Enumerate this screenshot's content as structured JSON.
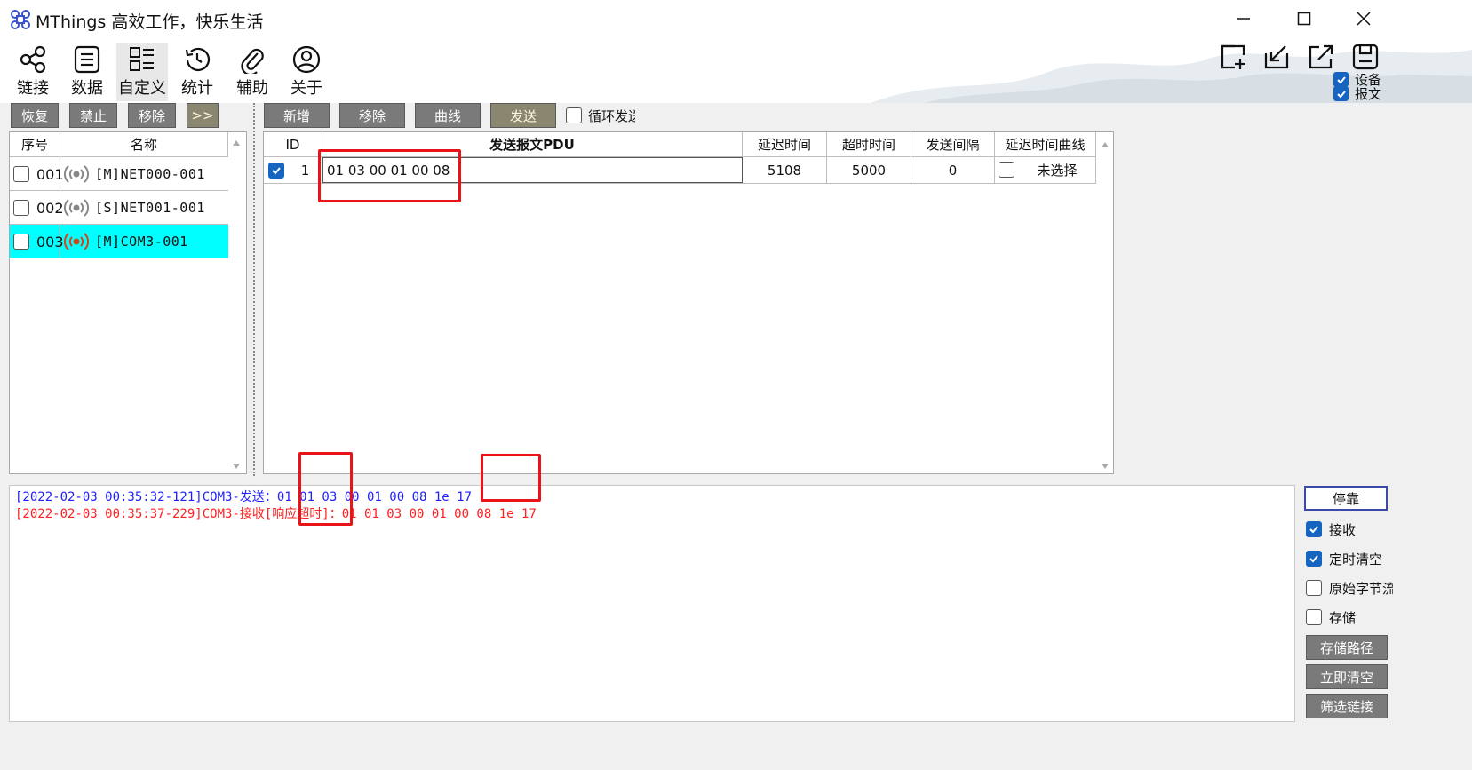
{
  "window": {
    "title": "MThings  高效工作，快乐生活",
    "controls": [
      "minimize-icon",
      "maximize-icon",
      "close-icon"
    ]
  },
  "toolbar": {
    "items": [
      {
        "label": "链接",
        "icon": "share-icon"
      },
      {
        "label": "数据",
        "icon": "list-icon"
      },
      {
        "label": "自定义",
        "icon": "grid-list-icon",
        "active": true
      },
      {
        "label": "统计",
        "icon": "history-icon"
      },
      {
        "label": "辅助",
        "icon": "paperclip-icon"
      },
      {
        "label": "关于",
        "icon": "user-icon"
      }
    ],
    "right_icons": [
      "add-window-icon",
      "import-icon",
      "export-icon",
      "save-icon"
    ],
    "right_checks": [
      {
        "label": "设备",
        "checked": true
      },
      {
        "label": "报文",
        "checked": true
      }
    ]
  },
  "device_panel": {
    "buttons": [
      "恢复",
      "禁止",
      "移除",
      ">>"
    ],
    "columns": [
      "序号",
      "名称"
    ],
    "rows": [
      {
        "num": "001",
        "name": "[M]NET000-001",
        "checked": false,
        "selected": false
      },
      {
        "num": "002",
        "name": "[S]NET001-001",
        "checked": false,
        "selected": false
      },
      {
        "num": "003",
        "name": "[M]COM3-001",
        "checked": false,
        "selected": true
      }
    ]
  },
  "send_panel": {
    "buttons": [
      "新增",
      "移除",
      "曲线",
      "发送"
    ],
    "loop_label": "循环发送",
    "loop_checked": false,
    "columns": [
      "ID",
      "发送报文PDU",
      "延迟时间",
      "超时时间",
      "发送间隔",
      "延迟时间曲线"
    ],
    "rows": [
      {
        "checked": true,
        "id": "1",
        "pdu": "01 03 00 01 00 08",
        "delay": "5108",
        "timeout": "5000",
        "interval": "0",
        "curve_checked": false,
        "curve": "未选择"
      }
    ]
  },
  "log": {
    "lines": [
      {
        "text": "[2022-02-03 00:35:32-121]COM3-发送：01 01 03 00 01 00 08 1e 17",
        "color": "#2020ff"
      },
      {
        "text": "[2022-02-03 00:35:37-229]COM3-接收[响应超时]：01 01 03 00 01 00 08 1e 17",
        "color": "#ff2020"
      }
    ]
  },
  "side_panel": {
    "dock_button": "停靠",
    "checks": [
      {
        "label": "接收",
        "checked": true
      },
      {
        "label": "定时清空",
        "checked": true
      },
      {
        "label": "原始字节流",
        "checked": false
      },
      {
        "label": "存储",
        "checked": false
      }
    ],
    "buttons": [
      "存储路径",
      "立即清空",
      "筛选链接"
    ]
  },
  "colors": {
    "accent": "#1565c0",
    "selected_row": "#00ffff",
    "highlight_box": "#e8141a",
    "send_text": "#2020ff",
    "recv_text": "#ff2020"
  }
}
